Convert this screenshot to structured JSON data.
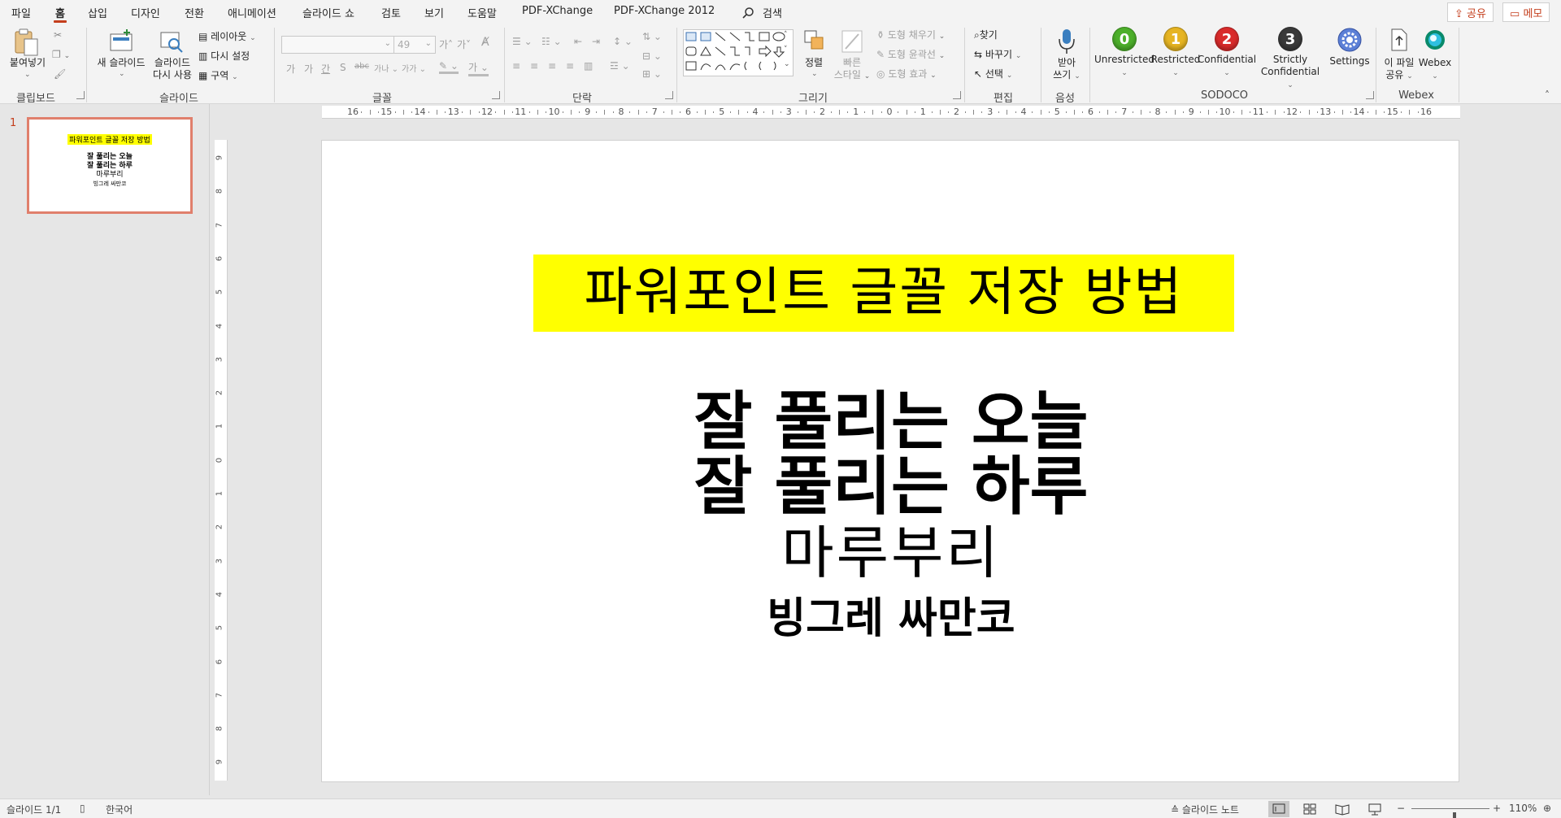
{
  "menu": {
    "tabs": [
      "파일",
      "홈",
      "삽입",
      "디자인",
      "전환",
      "애니메이션",
      "슬라이드 쇼",
      "검토",
      "보기",
      "도움말",
      "PDF-XChange",
      "PDF-XChange 2012"
    ],
    "active_tab": "홈",
    "search_label": "검색",
    "share_label": "공유",
    "memo_label": "메모"
  },
  "ribbon": {
    "groups": {
      "clipboard": "클립보드",
      "slides": "슬라이드",
      "font": "글꼴",
      "paragraph": "단락",
      "drawing": "그리기",
      "editing": "편집",
      "voice": "음성",
      "sodoco": "SODOCO",
      "webex": "Webex"
    },
    "paste_label": "붙여넣기",
    "new_slide_label": "새 슬라이드",
    "reuse_slide_label_1": "슬라이드",
    "reuse_slide_label_2": "다시 사용",
    "layout_label": "레이아웃",
    "reset_label": "다시 설정",
    "section_label": "구역",
    "font_size_value": "49",
    "arrange_label": "정렬",
    "quick_styles_label_1": "빠른",
    "quick_styles_label_2": "스타일",
    "shape_fill_label": "도형 채우기",
    "shape_outline_label": "도형 윤곽선",
    "shape_effects_label": "도형 효과",
    "find_label": "찾기",
    "replace_label": "바꾸기",
    "select_label": "선택",
    "dictate_label_1": "받아",
    "dictate_label_2": "쓰기",
    "sodoco_buttons": [
      {
        "badge": "0",
        "label": "Unrestricted",
        "color": "#4caf2a"
      },
      {
        "badge": "1",
        "label": "Restricted",
        "color": "#e0a800"
      },
      {
        "badge": "2",
        "label": "Confidential",
        "color": "#d92b2b"
      },
      {
        "badge": "3",
        "label_1": "Strictly",
        "label_2": "Confidential",
        "color": "#3a3a3a"
      }
    ],
    "settings_label": "Settings",
    "share_file_label_1": "이 파일",
    "share_file_label_2": "공유",
    "webex_label": "Webex"
  },
  "rulers": {
    "horizontal_ticks": [
      "16",
      "15",
      "14",
      "13",
      "12",
      "11",
      "10",
      "9",
      "8",
      "7",
      "6",
      "5",
      "4",
      "3",
      "2",
      "1",
      "0",
      "1",
      "2",
      "3",
      "4",
      "5",
      "6",
      "7",
      "8",
      "9",
      "10",
      "11",
      "12",
      "13",
      "14",
      "15",
      "16"
    ],
    "vertical_ticks": [
      "9",
      "8",
      "7",
      "6",
      "5",
      "4",
      "3",
      "2",
      "1",
      "0",
      "1",
      "2",
      "3",
      "4",
      "5",
      "6",
      "7",
      "8",
      "9"
    ]
  },
  "thumbnail": {
    "number": "1",
    "title": "파워포인트 글꼴 저장 방법",
    "line1": "잘 풀리는 오늘",
    "line2": "잘 풀리는 하루",
    "line3": "마루부리",
    "line4": "빙그레 싸만코"
  },
  "slide": {
    "title": "파워포인트 글꼴 저장 방법",
    "title_highlight": "#ffff00",
    "line1": "잘 풀리는 오늘",
    "line2": "잘 풀리는 하루",
    "line3": "마루부리",
    "line4": "빙그레 싸만코"
  },
  "status": {
    "slide_count": "슬라이드 1/1",
    "language": "한국어",
    "notes_label": "슬라이드 노트",
    "zoom": "110%",
    "zoom_fraction": 0.55,
    "accent": "#c43e1c"
  }
}
